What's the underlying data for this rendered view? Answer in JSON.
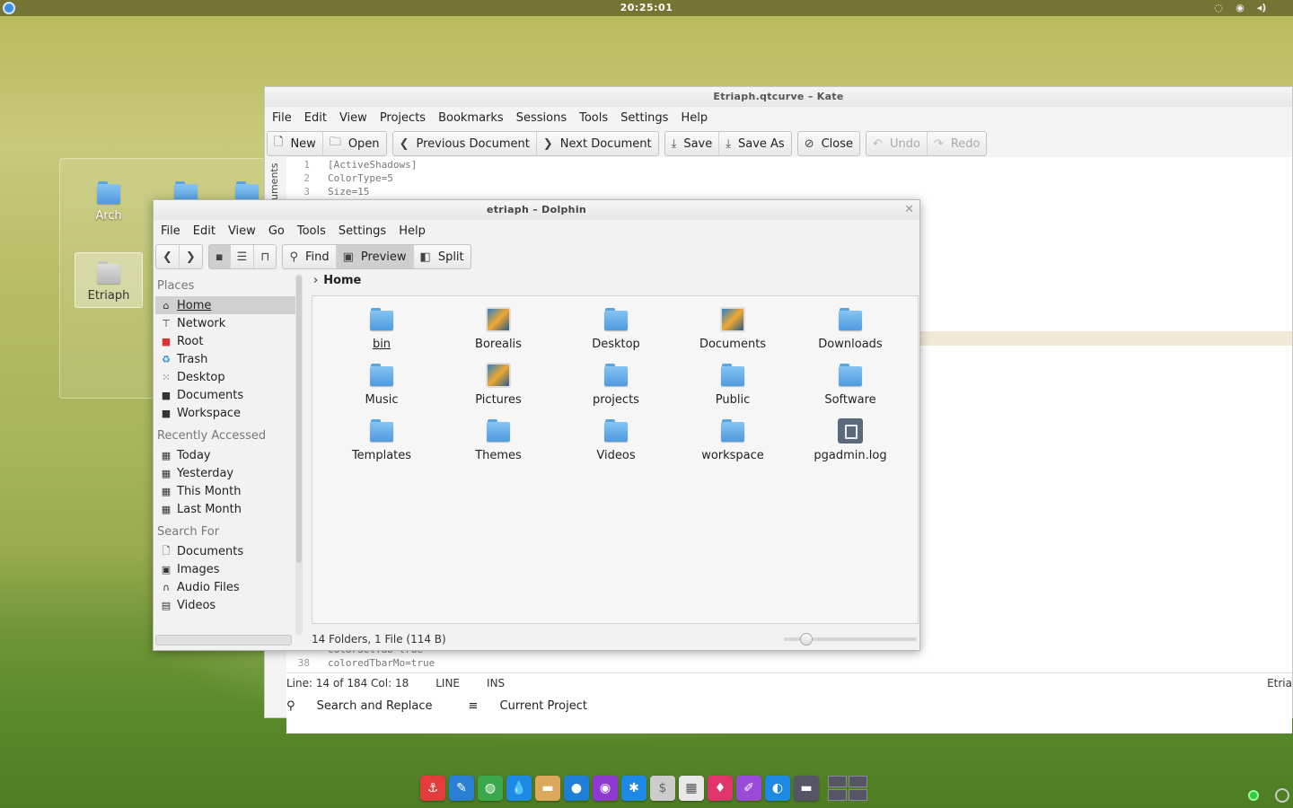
{
  "top_panel": {
    "clock": "20:25:01",
    "tray_icons": [
      "network-icon",
      "volume-icon"
    ]
  },
  "desktop": {
    "folders": [
      {
        "label": "Arch",
        "icon": "folder-icon"
      },
      {
        "label": "",
        "icon": "folder-icon"
      },
      {
        "label": "",
        "icon": "folder-icon"
      },
      {
        "label": "Etriaph",
        "icon": "folder-grey-icon"
      }
    ]
  },
  "kate": {
    "title": "Etriaph.qtcurve – Kate",
    "menu": [
      "File",
      "Edit",
      "View",
      "Projects",
      "Bookmarks",
      "Sessions",
      "Tools",
      "Settings",
      "Help"
    ],
    "toolbar": {
      "new": "New",
      "open": "Open",
      "prev_doc": "Previous Document",
      "next_doc": "Next Document",
      "save": "Save",
      "save_as": "Save As",
      "close": "Close",
      "undo": "Undo",
      "redo": "Redo"
    },
    "side_tab": "uments",
    "code": [
      {
        "n": "1",
        "t": "[ActiveShadows]"
      },
      {
        "n": "2",
        "t": "ColorType=5"
      },
      {
        "n": "3",
        "t": "Size=15"
      },
      {
        "n": "",
        "t": "colorSelTab=true"
      },
      {
        "n": "38",
        "t": "coloredTbarMo=true"
      }
    ],
    "status": {
      "position": "Line: 14 of 184 Col: 18",
      "mode": "LINE",
      "insert": "INS",
      "right": "Etria"
    },
    "bottom_tabs": {
      "search": "Search and Replace",
      "project": "Current Project"
    }
  },
  "dolphin": {
    "title": "etriaph – Dolphin",
    "menu": [
      "File",
      "Edit",
      "View",
      "Go",
      "Tools",
      "Settings",
      "Help"
    ],
    "toolbar": {
      "find": "Find",
      "preview": "Preview",
      "split": "Split"
    },
    "places": {
      "groups": [
        {
          "title": "Places",
          "items": [
            {
              "label": "Home",
              "icon": "home-icon",
              "active": true
            },
            {
              "label": "Network",
              "icon": "network-icon"
            },
            {
              "label": "Root",
              "icon": "root-icon"
            },
            {
              "label": "Trash",
              "icon": "trash-icon"
            },
            {
              "label": "Desktop",
              "icon": "desktop-icon"
            },
            {
              "label": "Documents",
              "icon": "documents-icon"
            },
            {
              "label": "Workspace",
              "icon": "workspace-icon"
            }
          ]
        },
        {
          "title": "Recently Accessed",
          "items": [
            {
              "label": "Today",
              "icon": "calendar-icon"
            },
            {
              "label": "Yesterday",
              "icon": "calendar-icon"
            },
            {
              "label": "This Month",
              "icon": "calendar-icon"
            },
            {
              "label": "Last Month",
              "icon": "calendar-icon"
            }
          ]
        },
        {
          "title": "Search For",
          "items": [
            {
              "label": "Documents",
              "icon": "document-search-icon"
            },
            {
              "label": "Images",
              "icon": "image-icon"
            },
            {
              "label": "Audio Files",
              "icon": "audio-icon"
            },
            {
              "label": "Videos",
              "icon": "video-icon"
            }
          ]
        }
      ]
    },
    "breadcrumb": "Home",
    "files": [
      {
        "label": "bin",
        "type": "folder",
        "selected": true
      },
      {
        "label": "Borealis",
        "type": "picture-folder"
      },
      {
        "label": "Desktop",
        "type": "folder"
      },
      {
        "label": "Documents",
        "type": "picture-folder"
      },
      {
        "label": "Downloads",
        "type": "folder"
      },
      {
        "label": "Music",
        "type": "folder"
      },
      {
        "label": "Pictures",
        "type": "picture-folder"
      },
      {
        "label": "projects",
        "type": "folder"
      },
      {
        "label": "Public",
        "type": "folder"
      },
      {
        "label": "Software",
        "type": "folder"
      },
      {
        "label": "Templates",
        "type": "folder"
      },
      {
        "label": "Themes",
        "type": "folder"
      },
      {
        "label": "Videos",
        "type": "folder"
      },
      {
        "label": "workspace",
        "type": "folder"
      },
      {
        "label": "pgadmin.log",
        "type": "file"
      }
    ],
    "status": "14 Folders, 1 File (114 B)",
    "zoom_fraction": 0.12
  },
  "dock": {
    "apps": [
      {
        "icon": "anchor-icon",
        "color": "#e23c3c"
      },
      {
        "icon": "editor-icon",
        "color": "#2a7fd4"
      },
      {
        "icon": "browser-icon",
        "color": "#3aa84a"
      },
      {
        "icon": "droplet-icon",
        "color": "#1e88e5"
      },
      {
        "icon": "file-manager-icon",
        "color": "#d9a85a"
      },
      {
        "icon": "chat-icon",
        "color": "#1e7fd6"
      },
      {
        "icon": "media-icon",
        "color": "#8e3ad0"
      },
      {
        "icon": "kde-icon",
        "color": "#1e88e5"
      },
      {
        "icon": "dollar-icon",
        "color": "#cccccc"
      },
      {
        "icon": "calculator-icon",
        "color": "#e8e8e8"
      },
      {
        "icon": "drops-icon",
        "color": "#e0356a"
      },
      {
        "icon": "paint-icon",
        "color": "#9a4ad8"
      },
      {
        "icon": "network-manager-icon",
        "color": "#1e88e5"
      },
      {
        "icon": "toggle-icon",
        "color": "#555566"
      }
    ]
  }
}
